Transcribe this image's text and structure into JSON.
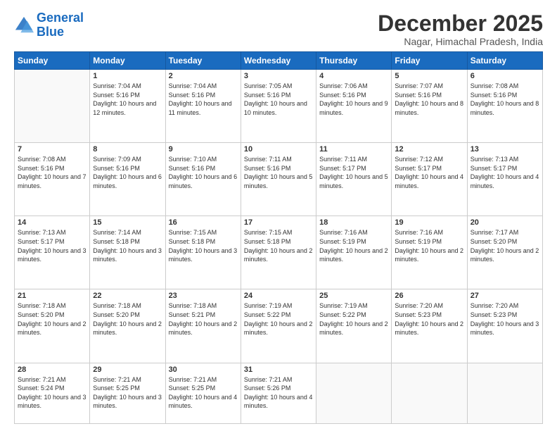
{
  "logo": {
    "line1": "General",
    "line2": "Blue"
  },
  "title": "December 2025",
  "location": "Nagar, Himachal Pradesh, India",
  "days_of_week": [
    "Sunday",
    "Monday",
    "Tuesday",
    "Wednesday",
    "Thursday",
    "Friday",
    "Saturday"
  ],
  "weeks": [
    [
      {
        "day": "",
        "sunrise": "",
        "sunset": "",
        "daylight": ""
      },
      {
        "day": "1",
        "sunrise": "Sunrise: 7:04 AM",
        "sunset": "Sunset: 5:16 PM",
        "daylight": "Daylight: 10 hours and 12 minutes."
      },
      {
        "day": "2",
        "sunrise": "Sunrise: 7:04 AM",
        "sunset": "Sunset: 5:16 PM",
        "daylight": "Daylight: 10 hours and 11 minutes."
      },
      {
        "day": "3",
        "sunrise": "Sunrise: 7:05 AM",
        "sunset": "Sunset: 5:16 PM",
        "daylight": "Daylight: 10 hours and 10 minutes."
      },
      {
        "day": "4",
        "sunrise": "Sunrise: 7:06 AM",
        "sunset": "Sunset: 5:16 PM",
        "daylight": "Daylight: 10 hours and 9 minutes."
      },
      {
        "day": "5",
        "sunrise": "Sunrise: 7:07 AM",
        "sunset": "Sunset: 5:16 PM",
        "daylight": "Daylight: 10 hours and 8 minutes."
      },
      {
        "day": "6",
        "sunrise": "Sunrise: 7:08 AM",
        "sunset": "Sunset: 5:16 PM",
        "daylight": "Daylight: 10 hours and 8 minutes."
      }
    ],
    [
      {
        "day": "7",
        "sunrise": "Sunrise: 7:08 AM",
        "sunset": "Sunset: 5:16 PM",
        "daylight": "Daylight: 10 hours and 7 minutes."
      },
      {
        "day": "8",
        "sunrise": "Sunrise: 7:09 AM",
        "sunset": "Sunset: 5:16 PM",
        "daylight": "Daylight: 10 hours and 6 minutes."
      },
      {
        "day": "9",
        "sunrise": "Sunrise: 7:10 AM",
        "sunset": "Sunset: 5:16 PM",
        "daylight": "Daylight: 10 hours and 6 minutes."
      },
      {
        "day": "10",
        "sunrise": "Sunrise: 7:11 AM",
        "sunset": "Sunset: 5:16 PM",
        "daylight": "Daylight: 10 hours and 5 minutes."
      },
      {
        "day": "11",
        "sunrise": "Sunrise: 7:11 AM",
        "sunset": "Sunset: 5:17 PM",
        "daylight": "Daylight: 10 hours and 5 minutes."
      },
      {
        "day": "12",
        "sunrise": "Sunrise: 7:12 AM",
        "sunset": "Sunset: 5:17 PM",
        "daylight": "Daylight: 10 hours and 4 minutes."
      },
      {
        "day": "13",
        "sunrise": "Sunrise: 7:13 AM",
        "sunset": "Sunset: 5:17 PM",
        "daylight": "Daylight: 10 hours and 4 minutes."
      }
    ],
    [
      {
        "day": "14",
        "sunrise": "Sunrise: 7:13 AM",
        "sunset": "Sunset: 5:17 PM",
        "daylight": "Daylight: 10 hours and 3 minutes."
      },
      {
        "day": "15",
        "sunrise": "Sunrise: 7:14 AM",
        "sunset": "Sunset: 5:18 PM",
        "daylight": "Daylight: 10 hours and 3 minutes."
      },
      {
        "day": "16",
        "sunrise": "Sunrise: 7:15 AM",
        "sunset": "Sunset: 5:18 PM",
        "daylight": "Daylight: 10 hours and 3 minutes."
      },
      {
        "day": "17",
        "sunrise": "Sunrise: 7:15 AM",
        "sunset": "Sunset: 5:18 PM",
        "daylight": "Daylight: 10 hours and 2 minutes."
      },
      {
        "day": "18",
        "sunrise": "Sunrise: 7:16 AM",
        "sunset": "Sunset: 5:19 PM",
        "daylight": "Daylight: 10 hours and 2 minutes."
      },
      {
        "day": "19",
        "sunrise": "Sunrise: 7:16 AM",
        "sunset": "Sunset: 5:19 PM",
        "daylight": "Daylight: 10 hours and 2 minutes."
      },
      {
        "day": "20",
        "sunrise": "Sunrise: 7:17 AM",
        "sunset": "Sunset: 5:20 PM",
        "daylight": "Daylight: 10 hours and 2 minutes."
      }
    ],
    [
      {
        "day": "21",
        "sunrise": "Sunrise: 7:18 AM",
        "sunset": "Sunset: 5:20 PM",
        "daylight": "Daylight: 10 hours and 2 minutes."
      },
      {
        "day": "22",
        "sunrise": "Sunrise: 7:18 AM",
        "sunset": "Sunset: 5:20 PM",
        "daylight": "Daylight: 10 hours and 2 minutes."
      },
      {
        "day": "23",
        "sunrise": "Sunrise: 7:18 AM",
        "sunset": "Sunset: 5:21 PM",
        "daylight": "Daylight: 10 hours and 2 minutes."
      },
      {
        "day": "24",
        "sunrise": "Sunrise: 7:19 AM",
        "sunset": "Sunset: 5:22 PM",
        "daylight": "Daylight: 10 hours and 2 minutes."
      },
      {
        "day": "25",
        "sunrise": "Sunrise: 7:19 AM",
        "sunset": "Sunset: 5:22 PM",
        "daylight": "Daylight: 10 hours and 2 minutes."
      },
      {
        "day": "26",
        "sunrise": "Sunrise: 7:20 AM",
        "sunset": "Sunset: 5:23 PM",
        "daylight": "Daylight: 10 hours and 2 minutes."
      },
      {
        "day": "27",
        "sunrise": "Sunrise: 7:20 AM",
        "sunset": "Sunset: 5:23 PM",
        "daylight": "Daylight: 10 hours and 3 minutes."
      }
    ],
    [
      {
        "day": "28",
        "sunrise": "Sunrise: 7:21 AM",
        "sunset": "Sunset: 5:24 PM",
        "daylight": "Daylight: 10 hours and 3 minutes."
      },
      {
        "day": "29",
        "sunrise": "Sunrise: 7:21 AM",
        "sunset": "Sunset: 5:25 PM",
        "daylight": "Daylight: 10 hours and 3 minutes."
      },
      {
        "day": "30",
        "sunrise": "Sunrise: 7:21 AM",
        "sunset": "Sunset: 5:25 PM",
        "daylight": "Daylight: 10 hours and 4 minutes."
      },
      {
        "day": "31",
        "sunrise": "Sunrise: 7:21 AM",
        "sunset": "Sunset: 5:26 PM",
        "daylight": "Daylight: 10 hours and 4 minutes."
      },
      {
        "day": "",
        "sunrise": "",
        "sunset": "",
        "daylight": ""
      },
      {
        "day": "",
        "sunrise": "",
        "sunset": "",
        "daylight": ""
      },
      {
        "day": "",
        "sunrise": "",
        "sunset": "",
        "daylight": ""
      }
    ]
  ]
}
